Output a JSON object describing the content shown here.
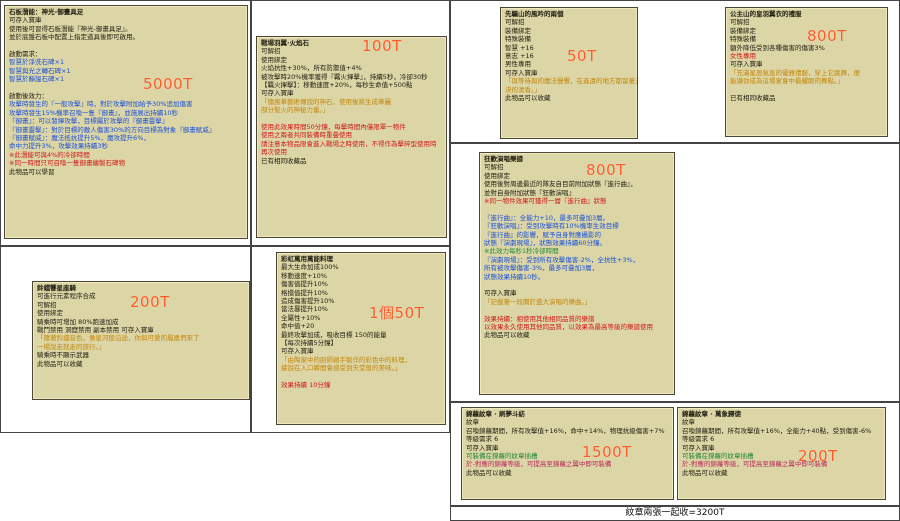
{
  "colors": {
    "tooltip_bg": "#dcd6a6",
    "price": "#ff5a2a",
    "blue": "#1a50d8",
    "red": "#d01818",
    "green": "#23863a",
    "orange": "#c4860a"
  },
  "tooltips": [
    {
      "id": "stone",
      "price": "5000T",
      "lines": [
        {
          "c": "ttl",
          "t": "石板潛能：神光-御畫具足"
        },
        {
          "c": "w",
          "t": "可存入寶庫"
        },
        {
          "c": "w",
          "t": "使用後可習得石板潛能『神光-御畫具足』。"
        },
        {
          "c": "w",
          "t": "並於底盤石板中配置上指定道具後即可啟用。"
        },
        {
          "c": "w",
          "t": ""
        },
        {
          "c": "w",
          "t": "啟動需求："
        },
        {
          "c": "b",
          "t": "智慧於淨洗石碑×1"
        },
        {
          "c": "b",
          "t": "智慧與光之轉石碑×1"
        },
        {
          "c": "b",
          "t": "智慧於靜謐石碑×1"
        },
        {
          "c": "w",
          "t": ""
        },
        {
          "c": "w",
          "t": "啟動後效力："
        },
        {
          "c": "b",
          "t": "攻擊時發生的『一般攻擊』時，對於攻擊附加給予30%追加傷害"
        },
        {
          "c": "b",
          "t": "攻擊時發生15%機率召喚一隻『御畫』，並施展出持續10秒"
        },
        {
          "c": "b",
          "t": "『御畫』：可以發揮攻擊，目標屬於攻擊的『御畫靈擊』"
        },
        {
          "c": "b",
          "t": "『御畫靈擊』：對於目標的敵人傷害30%的方向目標為對象『御畫賦威』"
        },
        {
          "c": "b",
          "t": "『御畫賦威』：魔法抵抗提升5%，魔攻提升6%，"
        },
        {
          "c": "b",
          "t": "        命中力提升3%，攻擊效果持續3秒"
        },
        {
          "c": "r",
          "t": "※此潛能可與4%的冷卻時間"
        },
        {
          "c": "r",
          "t": "※同一時間只可召喚一隻御畫繪製石碑物"
        },
        {
          "c": "w",
          "t": "此物品可以學習"
        }
      ]
    },
    {
      "id": "wing",
      "price": "100T",
      "lines": [
        {
          "c": "ttl",
          "t": "戰場羽翼·火焰石"
        },
        {
          "c": "w",
          "t": "可解招"
        },
        {
          "c": "w",
          "t": "使用綁定"
        },
        {
          "c": "w",
          "t": "火焰抗性+30%，所有防禦值+4%"
        },
        {
          "c": "w",
          "t": "被攻擊時20%機率獲得『羈火揮擊』，持續5秒，冷卻30秒"
        },
        {
          "c": "w",
          "t": "【羈火揮擊】：移動速度+20%，每秒生命值+500點"
        },
        {
          "c": "w",
          "t": "可存入寶庫"
        },
        {
          "c": "o",
          "t": "「隨風華藝術傳說的神石，使用後將生成華麗"
        },
        {
          "c": "o",
          "t": "部分聖火的神秘力量。」"
        },
        {
          "c": "w",
          "t": ""
        },
        {
          "c": "r",
          "t": "使用此效果時間50分鐘，每擊時間內僅限單一物件"
        },
        {
          "c": "r",
          "t": "使用之兩者共同裝備時重疊使用"
        },
        {
          "c": "r",
          "t": "請注意本物品限會進入戰場之時使用，不得作為擊碎型使用時"
        },
        {
          "c": "r",
          "t": "再次使用"
        },
        {
          "c": "w",
          "t": "已有相同收藏品"
        }
      ]
    },
    {
      "id": "bell",
      "price": "200T",
      "lines": [
        {
          "c": "ttl",
          "t": "鈴鐺響星座騎"
        },
        {
          "c": "w",
          "t": "可進行元素程序合成"
        },
        {
          "c": "w",
          "t": "可解招"
        },
        {
          "c": "w",
          "t": "使用綁定"
        },
        {
          "c": "w",
          "t": "騎乘時可增加 80%跑速加成"
        },
        {
          "c": "w",
          "t": "戰鬥禁用 洞窟禁用 副本禁用 可存入寶庫"
        },
        {
          "c": "o",
          "t": "「隨著鈴鐺音色，像星河般沿途，你與可愛的鳳凰們來了"
        },
        {
          "c": "o",
          "t": "一場說走就走的旅行。」"
        },
        {
          "c": "w",
          "t": "騎乘時不顯示武器"
        },
        {
          "c": "w",
          "t": "此物品可以收藏"
        }
      ]
    },
    {
      "id": "rainbow",
      "price": "1個50T",
      "lines": [
        {
          "c": "ttl",
          "t": "彩虹萬用萬能料理"
        },
        {
          "c": "w",
          "t": "最大生命加成100%"
        },
        {
          "c": "w",
          "t": "移動速度+10%"
        },
        {
          "c": "w",
          "t": "傷害值提升10%"
        },
        {
          "c": "w",
          "t": "格擋值提升10%"
        },
        {
          "c": "w",
          "t": "造成傷害提升10%"
        },
        {
          "c": "w",
          "t": "當法暴提升10%"
        },
        {
          "c": "w",
          "t": "全屬性+10%"
        },
        {
          "c": "w",
          "t": "命中值+20"
        },
        {
          "c": "w",
          "t": "最終攻擊加成，吸收目標 150的能量"
        },
        {
          "c": "w",
          "t": "【每次持續5分鐘】"
        },
        {
          "c": "w",
          "t": "可存入寶庫"
        },
        {
          "c": "o",
          "t": "「由陶家中的廚師親手製作的彩色中的料理，"
        },
        {
          "c": "o",
          "t": "據說在入口瞬間會感受到天堂般的美味。」"
        },
        {
          "c": "w",
          "t": ""
        },
        {
          "c": "r",
          "t": "效果持續 10分鐘"
        }
      ]
    },
    {
      "id": "aeolian",
      "price": "50T",
      "lines": [
        {
          "c": "ttl",
          "t": "先驅山的風吟的兩個"
        },
        {
          "c": "w",
          "t": "可解招"
        },
        {
          "c": "w",
          "t": "裝備綁定"
        },
        {
          "c": "w",
          "t": "特殊裝備"
        },
        {
          "c": "w",
          "t": "智慧 +16"
        },
        {
          "c": "w",
          "t": "意志 +16"
        },
        {
          "c": "w",
          "t": "男性專用"
        },
        {
          "c": "w",
          "t": "可存入寶庫"
        },
        {
          "c": "o",
          "t": "「與等待與的魔法聲響，在遙遠的地方都留著沒"
        },
        {
          "c": "o",
          "t": "決的清香。」"
        },
        {
          "c": "w",
          "t": "此物品可以收藏"
        }
      ]
    },
    {
      "id": "princess",
      "price": "800T",
      "lines": [
        {
          "c": "ttl",
          "t": "公主山的皇羽翼衣的禮服"
        },
        {
          "c": "w",
          "t": "可解招"
        },
        {
          "c": "w",
          "t": "裝備綁定"
        },
        {
          "c": "w",
          "t": "特殊裝備"
        },
        {
          "c": "w",
          "t": "額外降低受到各種傷害的傷害3%"
        },
        {
          "c": "r",
          "t": "女性專用"
        },
        {
          "c": "w",
          "t": "可存入寶庫"
        },
        {
          "c": "o",
          "t": "「充滿星辰氣息的優雅禮服，穿上它跳舞，便"
        },
        {
          "c": "o",
          "t": "能讓你成為這場宴會中最耀眼的舞點。」"
        },
        {
          "c": "w",
          "t": ""
        },
        {
          "c": "w",
          "t": "已有相同收藏品"
        }
      ]
    },
    {
      "id": "score",
      "price": "800T",
      "lines": [
        {
          "c": "ttl",
          "t": "狂歡演唱樂譜"
        },
        {
          "c": "w",
          "t": "可解招"
        },
        {
          "c": "w",
          "t": "使用綁定"
        },
        {
          "c": "w",
          "t": "使用後對周邊最近的隊友自目前附加狀態『進行曲』，"
        },
        {
          "c": "w",
          "t": "並對自身附加狀態『狂歡演唱』"
        },
        {
          "c": "r",
          "t": "※同一物件效果可獲得一層『進行曲』狀態"
        },
        {
          "c": "w",
          "t": ""
        },
        {
          "c": "b",
          "t": "『進行曲』：全能力+10，最多可疊加3層。"
        },
        {
          "c": "b",
          "t": "『狂歡演唱』：受到攻擊時有10%機率生效目標"
        },
        {
          "c": "b",
          "t": "        『進行曲』的影響，賦予自身對應攝影的"
        },
        {
          "c": "b",
          "t": "        狀態『演劇現場』，狀態效果持續60分鐘。"
        },
        {
          "c": "g",
          "t": "        ※此效力每秒1秒冷卻時間"
        },
        {
          "c": "b",
          "t": "『演劇現場』：受到所有攻擊傷害-2%，全抗性+3%，"
        },
        {
          "c": "b",
          "t": "        所有被攻擊傷害-3%，最多可疊加3層，"
        },
        {
          "c": "b",
          "t": "        狀態效果持續10秒。"
        },
        {
          "c": "w",
          "t": ""
        },
        {
          "c": "w",
          "t": "可存入寶庫"
        },
        {
          "c": "o",
          "t": "「記載著一段關於盛大演唱的樂曲。」"
        },
        {
          "c": "w",
          "t": ""
        },
        {
          "c": "r",
          "t": "效果持續：相使用其他相同品質的樂譜"
        },
        {
          "c": "r",
          "t": "以效果永久使用其他同品質，以效果為最高等級的樂譜使用"
        },
        {
          "c": "w",
          "t": "此物品可以收藏"
        }
      ]
    },
    {
      "id": "badge1",
      "price": "1500T",
      "lines": [
        {
          "c": "ttl",
          "t": "錦蘿紋章 · 刷夢斗紡"
        },
        {
          "c": "w",
          "t": "紋章"
        },
        {
          "c": "w",
          "t": "召喚錦蘿期間，所有攻擊值+16%，命中+14%，物理抗級傷害+7%"
        },
        {
          "c": "w",
          "t": "等級需求 6"
        },
        {
          "c": "w",
          "t": "可存入寶庫"
        },
        {
          "c": "g",
          "t": "可裝備在錦蘿的紋章插槽"
        },
        {
          "c": "pk",
          "t": "於-對應的錦蘿等級，可提高至錦蘿之翼中即可裝備"
        },
        {
          "c": "w",
          "t": "此物品可以收藏"
        }
      ]
    },
    {
      "id": "badge2",
      "price": "200T",
      "lines": [
        {
          "c": "ttl",
          "t": "錦蘿紋章 · 萬象歸德"
        },
        {
          "c": "w",
          "t": "紋章"
        },
        {
          "c": "w",
          "t": "召喚錦蘿期間，所有攻擊值+16%，全能力+40點，受到傷害-6%"
        },
        {
          "c": "w",
          "t": "等級需求 6"
        },
        {
          "c": "w",
          "t": "可存入寶庫"
        },
        {
          "c": "g",
          "t": "可裝備在錦蘿的紋章插槽"
        },
        {
          "c": "pk",
          "t": "於-對應的錦蘿等級，可提高至錦蘿之翼中即可裝備"
        },
        {
          "c": "w",
          "t": "此物品可以收藏"
        }
      ]
    }
  ],
  "footer": {
    "text": "紋章兩張一起收=3200T"
  }
}
